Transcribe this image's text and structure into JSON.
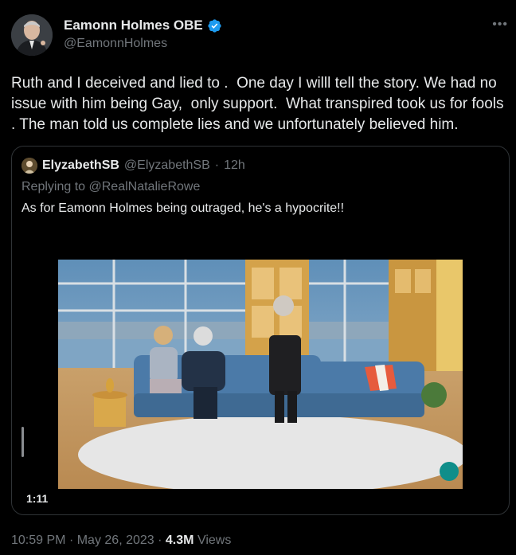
{
  "tweet": {
    "display_name": "Eamonn Holmes OBE",
    "handle": "@EamonnHolmes",
    "text": "Ruth and I deceived and lied to .  One day I willl tell the story. We had no issue with him being Gay,  only support.  What transpired took us for fools . The man told us complete lies and we unfortunately believed him.",
    "more_icon": "more-icon",
    "verified_color": "#1d9bf0"
  },
  "quote": {
    "display_name": "ElyzabethSB",
    "handle": "@ElyzabethSB",
    "separator": "·",
    "time": "12h",
    "replying_to_prefix": "Replying to ",
    "replying_to_handle": "@RealNatalieRowe",
    "text": "As for Eamonn Holmes being outraged, he's a hypocrite!!",
    "video_duration": "1:11"
  },
  "footer": {
    "time": "10:59 PM",
    "sep1": "·",
    "date": "May 26, 2023",
    "sep2": "·",
    "views_count": "4.3M",
    "views_label": "Views"
  },
  "colors": {
    "background": "#000000",
    "text": "#e7e9ea",
    "secondary": "#71767b",
    "border": "#2f3336",
    "brand_badge": "#0f8e8a"
  }
}
